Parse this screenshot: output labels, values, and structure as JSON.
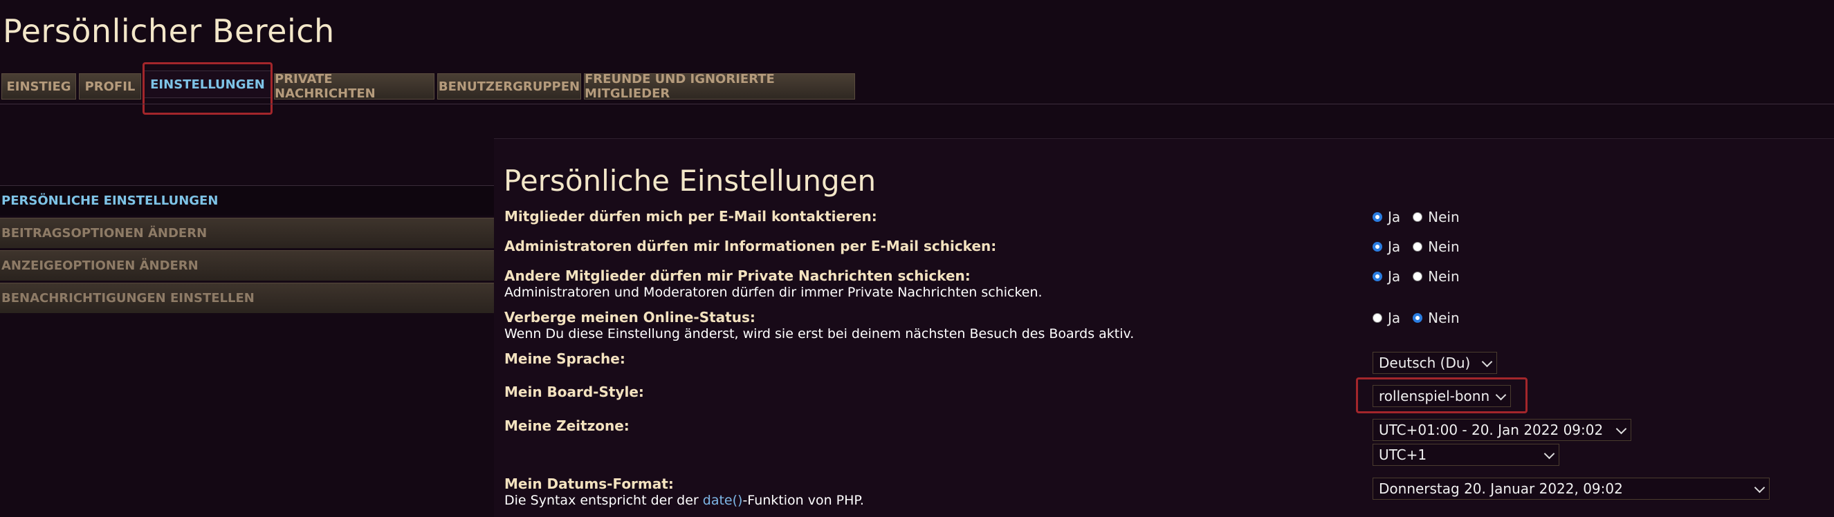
{
  "page_title": "Persönlicher Bereich",
  "tabs": [
    {
      "label": "EINSTIEG"
    },
    {
      "label": "PROFIL"
    },
    {
      "label": "EINSTELLUNGEN",
      "active": true
    },
    {
      "label": "PRIVATE NACHRICHTEN"
    },
    {
      "label": "BENUTZERGRUPPEN"
    },
    {
      "label": "FREUNDE UND IGNORIERTE MITGLIEDER"
    }
  ],
  "sidebar": {
    "items": [
      {
        "label": "PERSÖNLICHE EINSTELLUNGEN",
        "active": true
      },
      {
        "label": "BEITRAGSOPTIONEN ÄNDERN"
      },
      {
        "label": "ANZEIGEOPTIONEN ÄNDERN"
      },
      {
        "label": "BENACHRICHTIGUNGEN EINSTELLEN"
      }
    ]
  },
  "main": {
    "title": "Persönliche Einstellungen",
    "yes_label": "Ja",
    "no_label": "Nein",
    "settings": [
      {
        "label": "Mitglieder dürfen mich per E-Mail kontaktieren:",
        "selected": "Ja"
      },
      {
        "label": "Administratoren dürfen mir Informationen per E-Mail schicken:",
        "selected": "Ja"
      },
      {
        "label": "Andere Mitglieder dürfen mir Private Nachrichten schicken:",
        "hint": "Administratoren und Moderatoren dürfen dir immer Private Nachrichten schicken.",
        "selected": "Ja"
      },
      {
        "label": "Verberge meinen Online-Status:",
        "hint": "Wenn Du diese Einstellung änderst, wird sie erst bei deinem nächsten Besuch des Boards aktiv.",
        "selected": "Nein"
      }
    ],
    "language": {
      "label": "Meine Sprache:",
      "value": "Deutsch (Du)"
    },
    "style": {
      "label": "Mein Board-Style:",
      "value": "rollenspiel-bonn"
    },
    "timezone": {
      "label": "Meine Zeitzone:",
      "value": "UTC+01:00 - 20. Jan 2022 09:02",
      "zone": "UTC+1"
    },
    "date_format": {
      "label": "Mein Datums-Format:",
      "hint_before": "Die Syntax entspricht der der ",
      "hint_link": "date()",
      "hint_after": "-Funktion von PHP.",
      "value": "Donnerstag 20. Januar 2022, 09:02"
    }
  },
  "colors": {
    "accent": "#7ec3e6",
    "highlight": "#a3262b",
    "label": "#f3e2bf",
    "radio": "#2a7de1"
  }
}
